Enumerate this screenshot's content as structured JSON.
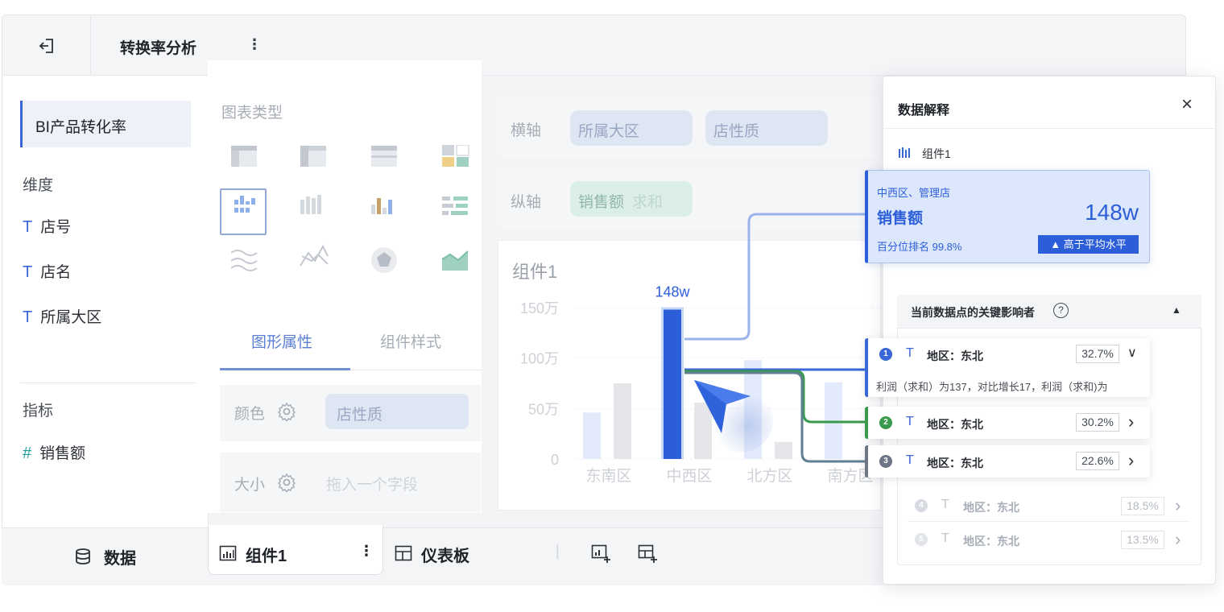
{
  "app": {
    "title": "转换率分析",
    "menu_glyph": "⋮"
  },
  "left_panel": {
    "dataset": "BI产品转化率",
    "dimension_heading": "维度",
    "dimensions": [
      "店号",
      "店名",
      "所属大区"
    ],
    "measure_heading": "指标",
    "measures": [
      "销售额"
    ],
    "dim_glyph": "T",
    "measure_glyph": "#"
  },
  "chart_type": {
    "heading": "图表类型",
    "options": [
      "detail-table",
      "cross-table",
      "group-table",
      "color-table",
      "column-chart",
      "stacked-column-chart",
      "multi-column-chart",
      "bar-chart",
      "wave-chart",
      "line-chart",
      "radar-chart",
      "area-chart"
    ],
    "selected": "column-chart"
  },
  "props": {
    "tab_graphic": "图形属性",
    "tab_style": "组件样式",
    "color_label": "颜色",
    "color_field": "店性质",
    "size_label": "大小",
    "size_placeholder": "拖入一个字段"
  },
  "axes": {
    "x_label": "横轴",
    "x_fields": [
      "所属大区",
      "店性质"
    ],
    "y_label": "纵轴",
    "y_field": "销售额",
    "y_agg": "求和"
  },
  "chart": {
    "title": "组件1",
    "highlight_label": "148w"
  },
  "chart_data": {
    "type": "bar",
    "title": "组件1",
    "categories": [
      "东南区",
      "中西区",
      "北方区",
      "南方区"
    ],
    "y_ticks": [
      "150万",
      "100万",
      "50万",
      "0"
    ],
    "ylim": [
      0,
      150
    ],
    "series": [
      {
        "values": [
          46,
          75
        ]
      },
      {
        "values": [
          148,
          56
        ]
      },
      {
        "values": [
          98,
          17
        ]
      },
      {
        "values": [
          76,
          0
        ]
      }
    ],
    "highlight": {
      "category": "中西区",
      "value": 148,
      "label": "148w"
    },
    "colors": {
      "highlight": "#2b5ed8",
      "faded_blue": "#e2eafb",
      "faded_gray": "#e4e6ea"
    }
  },
  "bottom_tabs": {
    "data": "数据",
    "component": "组件1",
    "component_menu": "⋮",
    "dashboard": "仪表板",
    "separator": "|"
  },
  "drawer": {
    "title": "数据解释",
    "close": "×",
    "component": "组件1",
    "point": {
      "path": "中西区、管理店",
      "measure": "销售额",
      "value": "148w",
      "rank": "百分位排名 99.8%",
      "badge": "▲  高于平均水平"
    },
    "influencers_heading": "当前数据点的关键影响者",
    "help": "?",
    "collapse": "▲",
    "items": [
      {
        "rank": "1",
        "label": "地区：东北",
        "pct": "32.7%",
        "chev": "∨",
        "color": "#3a67d6",
        "desc": "利润（求和）为137，对比增长17，利润（求和)为"
      },
      {
        "rank": "2",
        "label": "地区：东北",
        "pct": "30.2%",
        "chev": "›",
        "color": "#3a9a4b"
      },
      {
        "rank": "3",
        "label": "地区：东北",
        "pct": "22.6%",
        "chev": "›",
        "color": "#6c7684"
      },
      {
        "rank": "4",
        "label": "地区：东北",
        "pct": "18.5%",
        "chev": "›",
        "color": "#c9ced6"
      },
      {
        "rank": "5",
        "label": "地区：东北",
        "pct": "13.5%",
        "chev": "›",
        "color": "#c9ced6"
      }
    ]
  }
}
